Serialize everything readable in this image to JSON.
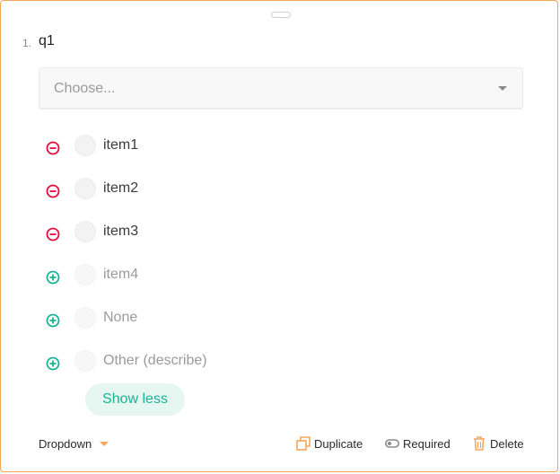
{
  "question": {
    "number": "1.",
    "title": "q1"
  },
  "dropdown": {
    "placeholder": "Choose..."
  },
  "choices": [
    {
      "label": "item1",
      "state": "remove"
    },
    {
      "label": "item2",
      "state": "remove"
    },
    {
      "label": "item3",
      "state": "remove"
    },
    {
      "label": "item4",
      "state": "add"
    },
    {
      "label": "None",
      "state": "add"
    },
    {
      "label": "Other (describe)",
      "state": "add"
    }
  ],
  "show_less_label": "Show less",
  "footer": {
    "type_label": "Dropdown",
    "duplicate_label": "Duplicate",
    "required_label": "Required",
    "delete_label": "Delete"
  },
  "colors": {
    "remove": "#e60a3e",
    "add": "#19b394",
    "accent": "#f3a65a"
  },
  "icons": {
    "remove": "minus-circle-icon",
    "add": "plus-circle-icon",
    "duplicate": "duplicate-icon",
    "required": "toggle-icon",
    "delete": "trash-icon"
  }
}
